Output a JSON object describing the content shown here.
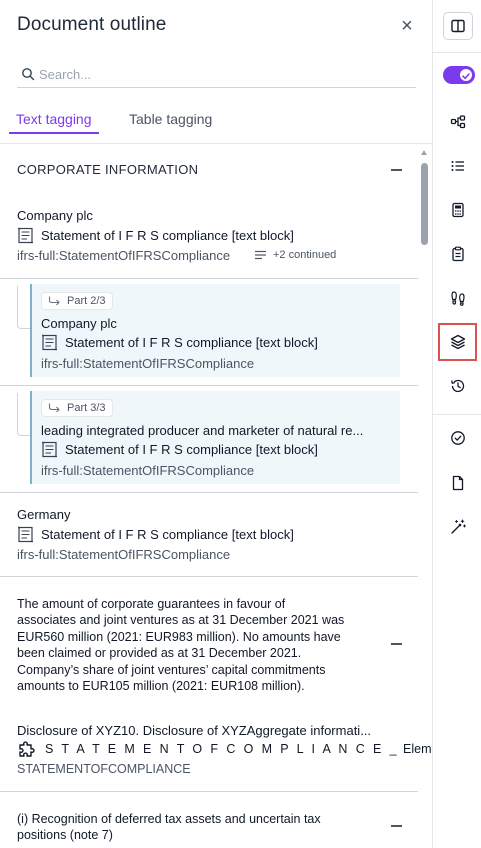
{
  "panel": {
    "title": "Document outline",
    "close_label": "×"
  },
  "search": {
    "placeholder": "Search...",
    "value": ""
  },
  "tabs": [
    {
      "label": "Text tagging",
      "active": true
    },
    {
      "label": "Table tagging",
      "active": false
    }
  ],
  "section": {
    "title": "CORPORATE INFORMATION"
  },
  "entries": [
    {
      "title": "Company plc",
      "element": "Statement of I F R S compliance [text block]",
      "concept": "ifrs-full:StatementOfIFRSCompliance",
      "continued": "+2 continued"
    },
    {
      "part": "Part 2/3",
      "title": "Company plc",
      "element": "Statement of I F R S compliance [text block]",
      "concept": "ifrs-full:StatementOfIFRSCompliance"
    },
    {
      "part": "Part 3/3",
      "title": "leading integrated producer and marketer of natural re...",
      "element": "Statement of I F R S compliance [text block]",
      "concept": "ifrs-full:StatementOfIFRSCompliance"
    },
    {
      "title": "Germany",
      "element": "Statement of I F R S compliance [text block]",
      "concept": "ifrs-full:StatementOfIFRSCompliance"
    }
  ],
  "paragraph": {
    "lines": [
      "The amount of corporate guarantees in favour of",
      "associates and joint ventures as at 31 December 2021 was",
      "EUR560 million (2021: EUR983 million). No amounts have",
      "been claimed or provided as at 31 December 2021.",
      "Company’s share of joint ventures’ capital commitments",
      "amounts to EUR105 million (2021: EUR108 million)."
    ],
    "disclosure": "Disclosure of XYZ10. Disclosure of XYZAggregate informati...",
    "element_name": "S T A T E M E N T O F C O M P L I A N C E _",
    "element_suffix": "Element",
    "concept": "STATEMENTOFCOMPLIANCE"
  },
  "next_item": {
    "lines": [
      "(i) Recognition of deferred tax assets and uncertain tax",
      "positions (note 7)"
    ]
  },
  "rail": {
    "items": [
      "panel-toggle-icon",
      "toggle-switch",
      "hierarchy-icon",
      "list-icon",
      "calculator-icon",
      "clipboard-icon",
      "footprints-icon",
      "layers-icon",
      "history-icon",
      "check-circle-icon",
      "document-icon",
      "magic-wand-icon"
    ],
    "active": "layers-icon",
    "accent": "#7c3aed",
    "highlight": "#d9534f"
  }
}
